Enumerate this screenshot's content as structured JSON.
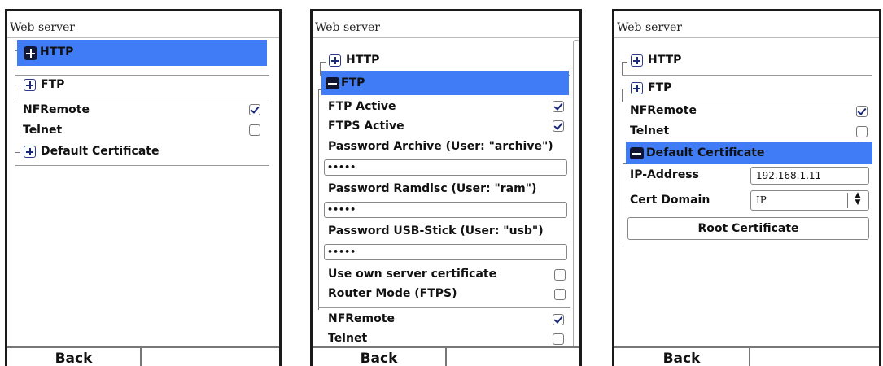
{
  "screens": [
    {
      "title": "Web server",
      "items": {
        "http": "HTTP",
        "ftp": "FTP",
        "nfremote": "NFRemote",
        "telnet": "Telnet",
        "default_cert": "Default Certificate"
      },
      "nfremote_checked": true,
      "telnet_checked": false,
      "back": "Back"
    },
    {
      "title": "Web server",
      "items": {
        "http": "HTTP",
        "ftp": "FTP",
        "ftp_active": "FTP Active",
        "ftps_active": "FTPS Active",
        "pw_archive": "Password Archive (User: \"archive\")",
        "pw_ramdisc": "Password Ramdisc (User: \"ram\")",
        "pw_usb": "Password USB-Stick (User: \"usb\")",
        "own_cert": "Use own server certificate",
        "router_mode": "Router Mode (FTPS)",
        "nfremote": "NFRemote",
        "telnet": "Telnet"
      },
      "pw_archive_value": "•••••",
      "pw_ramdisc_value": "•••••",
      "pw_usb_value": "•••••",
      "ftp_active_checked": true,
      "ftps_active_checked": true,
      "own_cert_checked": false,
      "router_mode_checked": false,
      "nfremote_checked": true,
      "telnet_checked": false,
      "back": "Back"
    },
    {
      "title": "Web server",
      "items": {
        "http": "HTTP",
        "ftp": "FTP",
        "nfremote": "NFRemote",
        "telnet": "Telnet",
        "default_cert": "Default Certificate",
        "ip_address": "IP-Address",
        "cert_domain": "Cert Domain",
        "root_cert": "Root Certificate"
      },
      "ip_address_value": "192.168.1.11",
      "cert_domain_value": "IP",
      "nfremote_checked": true,
      "telnet_checked": false,
      "back": "Back"
    }
  ],
  "colors": {
    "selection": "#3f7cf6",
    "icon_dark": "#12183a",
    "frame": "#1a1a1a"
  },
  "icons": [
    "plus-box-icon",
    "minus-box-icon",
    "checkbox-icon",
    "stepper-icon"
  ]
}
